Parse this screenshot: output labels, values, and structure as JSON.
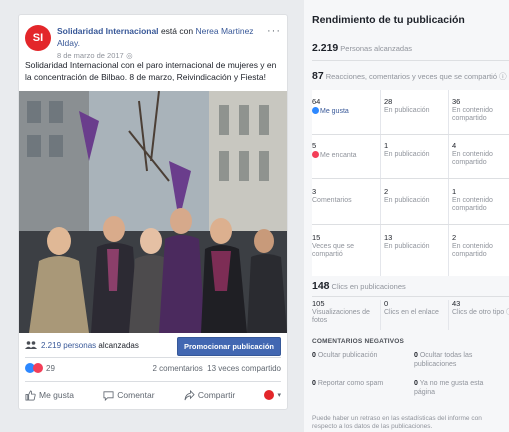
{
  "post": {
    "avatar_text": "SI",
    "page_name": "Solidaridad Internacional",
    "with_text": "está con",
    "friend_name": "Nerea Martinez Alday.",
    "date": "8 de marzo de 2017",
    "more_icon": "ellipsis-icon",
    "text": "Solidaridad Internacional con el paro internacional de mujeres y en la concentración de Bilbao. 8 de marzo, Reivindicación y Fiesta!",
    "reach_count": "2.219 personas",
    "reach_label": "alcanzadas",
    "promote_label": "Promocionar publicación",
    "reaction_count": "29",
    "comments": "2 comentarios",
    "shares": "13 veces compartido",
    "actions": {
      "like": "Me gusta",
      "comment": "Comentar",
      "share": "Compartir"
    }
  },
  "insights": {
    "title": "Rendimiento de tu publicación",
    "reach_num": "2.219",
    "reach_label": "Personas alcanzadas",
    "reactions_num": "87",
    "reactions_label": "Reacciones, comentarios y veces que se compartió",
    "rows": [
      {
        "c1_num": "64",
        "c1_label": "Me gusta",
        "c2_num": "28",
        "c2_label": "En publicación",
        "c3_num": "36",
        "c3_label": "En contenido compartido"
      },
      {
        "c1_num": "5",
        "c1_label": "Me encanta",
        "c2_num": "1",
        "c2_label": "En publicación",
        "c3_num": "4",
        "c3_label": "En contenido compartido"
      },
      {
        "c1_num": "3",
        "c1_label": "Comentarios",
        "c2_num": "2",
        "c2_label": "En publicación",
        "c3_num": "1",
        "c3_label": "En contenido compartido"
      },
      {
        "c1_num": "15",
        "c1_label": "Veces que se compartió",
        "c2_num": "13",
        "c2_label": "En publicación",
        "c3_num": "2",
        "c3_label": "En contenido compartido"
      }
    ],
    "clicks_num": "148",
    "clicks_label": "Clics en publicaciones",
    "click_rows": {
      "c1_num": "105",
      "c1_label": "Visualizaciones de fotos",
      "c2_num": "0",
      "c2_label": "Clics en el enlace",
      "c3_num": "43",
      "c3_label": "Clics de otro tipo"
    },
    "negative_heading": "COMENTARIOS NEGATIVOS",
    "negatives": [
      {
        "num": "0",
        "label": "Ocultar publicación"
      },
      {
        "num": "0",
        "label": "Ocultar todas las publicaciones"
      },
      {
        "num": "0",
        "label": "Reportar como spam"
      },
      {
        "num": "0",
        "label": "Ya no me gusta esta página"
      }
    ],
    "footnote": "Puede haber un retraso en las estadísticas del informe con respecto a los datos de las publicaciones."
  },
  "colors": {
    "brand_blue": "#4267b2",
    "link_blue": "#385898",
    "red": "#e3262a"
  }
}
